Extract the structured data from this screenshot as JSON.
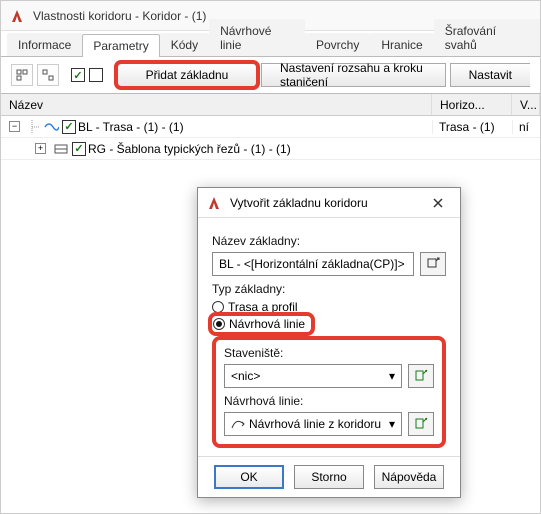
{
  "window": {
    "title": "Vlastnosti koridoru - Koridor - (1)"
  },
  "tabs": [
    "Informace",
    "Parametry",
    "Kódy",
    "Návrhové linie",
    "Povrchy",
    "Hranice",
    "Šrafování svahů"
  ],
  "active_tab_index": 1,
  "toolbar": {
    "add_baseline": "Přidat základnu",
    "set_range": "Nastavení rozsahu a kroku staničení",
    "set_partial": "Nastavit"
  },
  "grid": {
    "headers": {
      "name": "Název",
      "horiz": "Horizo...",
      "vert": "V..."
    },
    "rows": [
      {
        "depth": 0,
        "expander": "-",
        "checked": true,
        "icon": "baseline",
        "label": "BL - Trasa - (1) - (1)",
        "horiz": "Trasa - (1)",
        "vert": "ní"
      },
      {
        "depth": 1,
        "expander": "+",
        "checked": true,
        "icon": "template",
        "label": "RG - Šablona typických řezů - (1) - (1)",
        "horiz": "",
        "vert": ""
      }
    ]
  },
  "dialog": {
    "title": "Vytvořit základnu koridoru",
    "name_label": "Název základny:",
    "name_value": "BL - <[Horizontální základna(CP)]> - (<[Dal",
    "type_label": "Typ základny:",
    "radio_route": "Trasa a profil",
    "radio_feature": "Návrhová linie",
    "site_label": "Staveniště:",
    "site_value": "<nic>",
    "feature_label": "Návrhová linie:",
    "feature_value": "Návrhová linie z koridoru",
    "buttons": {
      "ok": "OK",
      "cancel": "Storno",
      "help": "Nápověda"
    }
  }
}
